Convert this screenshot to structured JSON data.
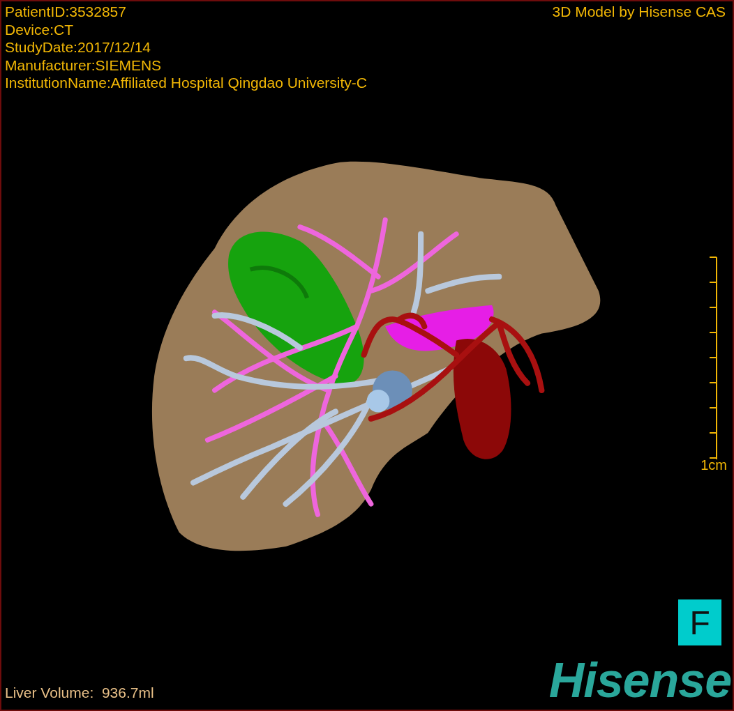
{
  "info_lines": [
    "PatientID:3532857",
    "Device:CT",
    "StudyDate:2017/12/14",
    "Manufacturer:SIEMENS",
    "InstitutionName:Affiliated Hospital Qingdao University-C"
  ],
  "title": "3D Model by Hisense CAS",
  "scale": {
    "label": "1cm"
  },
  "volume": "Liver Volume:  936.7ml",
  "orientation": "F",
  "logo": "Hisense"
}
